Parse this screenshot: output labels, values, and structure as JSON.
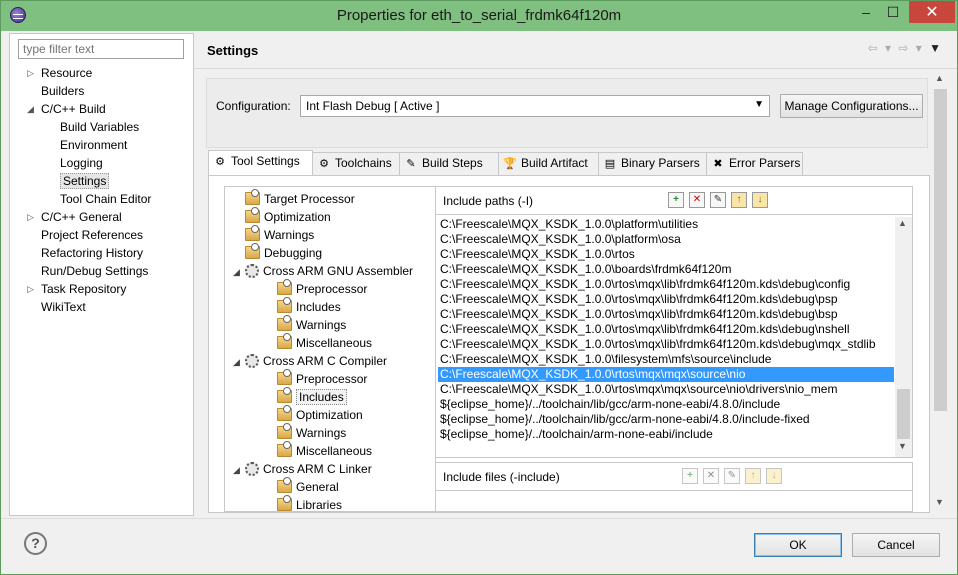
{
  "window": {
    "title": "Properties for eth_to_serial_frdmk64f120m",
    "minimize": "‒",
    "maximize": "☐",
    "close": "✕"
  },
  "filter": {
    "placeholder": "type filter text"
  },
  "left_tree": [
    {
      "label": "Resource",
      "expander": "▷",
      "indent": 0
    },
    {
      "label": "Builders",
      "expander": "",
      "indent": 0
    },
    {
      "label": "C/C++ Build",
      "expander": "◢",
      "indent": 0
    },
    {
      "label": "Build Variables",
      "expander": "",
      "indent": 1
    },
    {
      "label": "Environment",
      "expander": "",
      "indent": 1
    },
    {
      "label": "Logging",
      "expander": "",
      "indent": 1
    },
    {
      "label": "Settings",
      "expander": "",
      "indent": 1,
      "selected": true
    },
    {
      "label": "Tool Chain Editor",
      "expander": "",
      "indent": 1
    },
    {
      "label": "C/C++ General",
      "expander": "▷",
      "indent": 0
    },
    {
      "label": "Project References",
      "expander": "",
      "indent": 0
    },
    {
      "label": "Refactoring History",
      "expander": "",
      "indent": 0
    },
    {
      "label": "Run/Debug Settings",
      "expander": "",
      "indent": 0
    },
    {
      "label": "Task Repository",
      "expander": "▷",
      "indent": 0
    },
    {
      "label": "WikiText",
      "expander": "",
      "indent": 0
    }
  ],
  "settings": {
    "title": "Settings",
    "nav": "⇦ ▾ ⇨ ▾",
    "menu": "▼"
  },
  "configuration": {
    "label": "Configuration:",
    "value": "Int Flash Debug  [ Active ]",
    "arrow": "▼",
    "manage_label": "Manage Configurations..."
  },
  "tabs": [
    {
      "label": "Tool Settings",
      "icon": "⚙",
      "active": true
    },
    {
      "label": "Toolchains",
      "icon": "⚙"
    },
    {
      "label": "Build Steps",
      "icon": "✎"
    },
    {
      "label": "Build Artifact",
      "icon": "🏆"
    },
    {
      "label": "Binary Parsers",
      "icon": "▤"
    },
    {
      "label": "Error Parsers",
      "icon": "✖"
    }
  ],
  "tool_tree": [
    {
      "label": "Target Processor",
      "type": "folder",
      "level": 0
    },
    {
      "label": "Optimization",
      "type": "folder",
      "level": 0
    },
    {
      "label": "Warnings",
      "type": "folder",
      "level": 0
    },
    {
      "label": "Debugging",
      "type": "folder",
      "level": 0
    },
    {
      "label": "Cross ARM GNU Assembler",
      "type": "gear",
      "level": 0,
      "exp": "◢"
    },
    {
      "label": "Preprocessor",
      "type": "folder",
      "level": 1
    },
    {
      "label": "Includes",
      "type": "folder",
      "level": 1
    },
    {
      "label": "Warnings",
      "type": "folder",
      "level": 1
    },
    {
      "label": "Miscellaneous",
      "type": "folder",
      "level": 1
    },
    {
      "label": "Cross ARM C Compiler",
      "type": "gear",
      "level": 0,
      "exp": "◢"
    },
    {
      "label": "Preprocessor",
      "type": "folder",
      "level": 1
    },
    {
      "label": "Includes",
      "type": "folder",
      "level": 1,
      "selected": true
    },
    {
      "label": "Optimization",
      "type": "folder",
      "level": 1
    },
    {
      "label": "Warnings",
      "type": "folder",
      "level": 1
    },
    {
      "label": "Miscellaneous",
      "type": "folder",
      "level": 1
    },
    {
      "label": "Cross ARM C Linker",
      "type": "gear",
      "level": 0,
      "exp": "◢"
    },
    {
      "label": "General",
      "type": "folder",
      "level": 1
    },
    {
      "label": "Libraries",
      "type": "folder",
      "level": 1
    }
  ],
  "include_paths": {
    "title": "Include paths (-I)",
    "items": [
      "C:\\Freescale\\MQX_KSDK_1.0.0\\platform\\utilities",
      "C:\\Freescale\\MQX_KSDK_1.0.0\\platform\\osa",
      "C:\\Freescale\\MQX_KSDK_1.0.0\\rtos",
      "C:\\Freescale\\MQX_KSDK_1.0.0\\boards\\frdmk64f120m",
      "C:\\Freescale\\MQX_KSDK_1.0.0\\rtos\\mqx\\lib\\frdmk64f120m.kds\\debug\\config",
      "C:\\Freescale\\MQX_KSDK_1.0.0\\rtos\\mqx\\lib\\frdmk64f120m.kds\\debug\\psp",
      "C:\\Freescale\\MQX_KSDK_1.0.0\\rtos\\mqx\\lib\\frdmk64f120m.kds\\debug\\bsp",
      "C:\\Freescale\\MQX_KSDK_1.0.0\\rtos\\mqx\\lib\\frdmk64f120m.kds\\debug\\nshell",
      "C:\\Freescale\\MQX_KSDK_1.0.0\\rtos\\mqx\\lib\\frdmk64f120m.kds\\debug\\mqx_stdlib",
      "C:\\Freescale\\MQX_KSDK_1.0.0\\filesystem\\mfs\\source\\include",
      "C:\\Freescale\\MQX_KSDK_1.0.0\\rtos\\mqx\\mqx\\source\\nio",
      "C:\\Freescale\\MQX_KSDK_1.0.0\\rtos\\mqx\\mqx\\source\\nio\\drivers\\nio_mem",
      "${eclipse_home}/../toolchain/lib/gcc/arm-none-eabi/4.8.0/include",
      "${eclipse_home}/../toolchain/lib/gcc/arm-none-eabi/4.8.0/include-fixed",
      "${eclipse_home}/../toolchain/arm-none-eabi/include"
    ],
    "selected_index": 10,
    "scroll_up": "▲",
    "scroll_down": "▼"
  },
  "include_files": {
    "title": "Include files (-include)"
  },
  "toolbar_icons": {
    "add": "+",
    "delete": "✕",
    "edit": "✎",
    "up": "↑",
    "down": "↓"
  },
  "outer_scroll": {
    "up": "▲",
    "down": "▼"
  },
  "buttons": {
    "help": "?",
    "ok": "OK",
    "cancel": "Cancel"
  }
}
